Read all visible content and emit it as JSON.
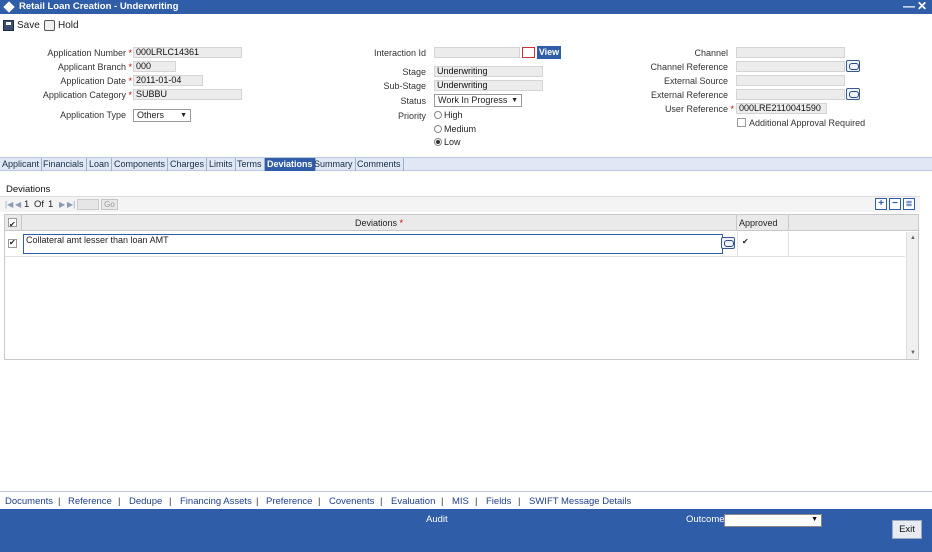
{
  "window": {
    "title": "Retail Loan Creation - Underwriting",
    "minimize": "—",
    "close": "✕"
  },
  "toolbar": {
    "save": "Save",
    "hold": "Hold"
  },
  "fields": {
    "application_number_label": "Application Number",
    "application_number": "000LRLC14361",
    "applicant_branch_label": "Applicant Branch",
    "applicant_branch": "000",
    "application_date_label": "Application Date",
    "application_date": "2011-01-04",
    "application_category_label": "Application Category",
    "application_category": "SUBBU",
    "application_type_label": "Application Type",
    "application_type": "Others",
    "interaction_id_label": "Interaction Id",
    "interaction_id": "",
    "view": "View",
    "stage_label": "Stage",
    "stage": "Underwriting",
    "sub_stage_label": "Sub-Stage",
    "sub_stage": "Underwriting",
    "status_label": "Status",
    "status": "Work In Progress",
    "priority_label": "Priority",
    "priority_options": [
      "High",
      "Medium",
      "Low"
    ],
    "priority_selected": "Low",
    "channel_label": "Channel",
    "channel": "",
    "channel_reference_label": "Channel Reference",
    "channel_reference": "",
    "external_source_label": "External Source",
    "external_source": "",
    "external_reference_label": "External Reference",
    "external_reference": "",
    "user_reference_label": "User Reference",
    "user_reference": "000LRE2110041590",
    "additional_approval_label": "Additional Approval Required",
    "additional_approval_checked": false
  },
  "tabs": [
    {
      "label": "Applicant",
      "active": false
    },
    {
      "label": "Financials",
      "active": false
    },
    {
      "label": "Loan",
      "active": false
    },
    {
      "label": "Components",
      "active": false
    },
    {
      "label": "Charges",
      "active": false
    },
    {
      "label": "Limits",
      "active": false
    },
    {
      "label": "Terms",
      "active": false
    },
    {
      "label": "Deviations",
      "active": true
    },
    {
      "label": "Summary",
      "active": false
    },
    {
      "label": "Comments",
      "active": false
    }
  ],
  "deviations": {
    "section_title": "Deviations",
    "pager": {
      "page": "1",
      "of_label": "Of",
      "total": "1",
      "go": "Go"
    },
    "columns": {
      "deviations": "Deviations",
      "approved": "Approved"
    },
    "rows": [
      {
        "selected": true,
        "deviation": "Collateral amt lesser than loan AMT",
        "approved": true
      }
    ]
  },
  "footer": {
    "links": [
      "Documents",
      "Reference",
      "Dedupe",
      "Financing Assets",
      "Preference",
      "Covenents",
      "Evaluation",
      "MIS",
      "Fields",
      "SWIFT Message Details"
    ],
    "separator": "|",
    "audit": "Audit",
    "outcome_label": "Outcome",
    "outcome": "",
    "exit": "Exit"
  },
  "colors": {
    "brand": "#2f5da8",
    "required": "#cc0000"
  }
}
